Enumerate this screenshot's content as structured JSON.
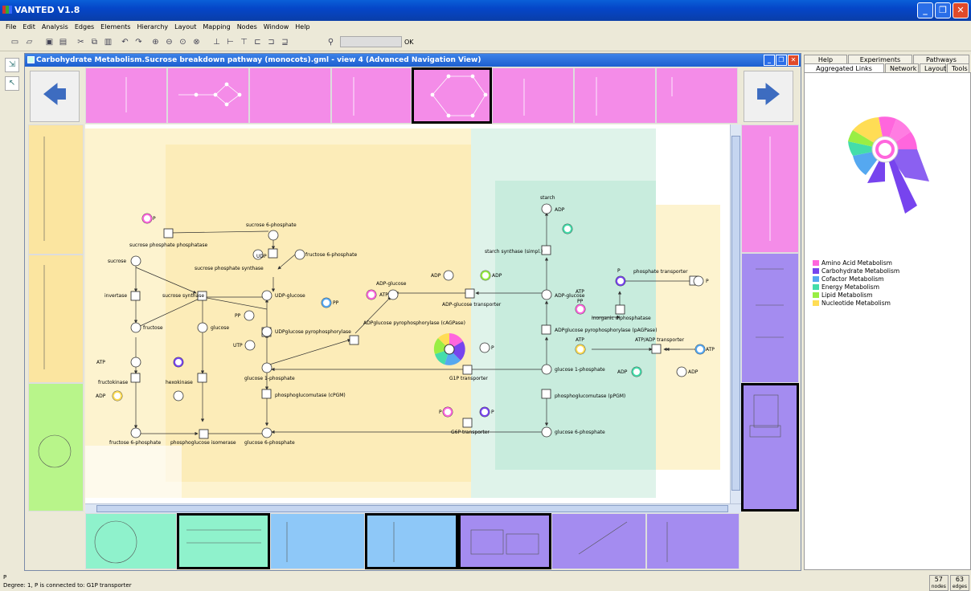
{
  "app": {
    "title": "VANTED V1.8"
  },
  "menu": [
    "File",
    "Edit",
    "Analysis",
    "Edges",
    "Elements",
    "Hierarchy",
    "Layout",
    "Mapping",
    "Nodes",
    "Window",
    "Help"
  ],
  "toolbar": {
    "search_value": "",
    "ok_label": "OK"
  },
  "internal_window": {
    "title": "Carbohydrate Metabolism.Sucrose breakdown pathway (monocots).gml - view 4 (Advanced Navigation View)"
  },
  "right_panel": {
    "tabs_row1": [
      "Help",
      "Experiments",
      "Pathways"
    ],
    "tabs_row2": [
      "Aggregated Links View",
      "Network",
      "Layout",
      "Tools"
    ],
    "active_tab": "Aggregated Links View",
    "legend": [
      {
        "label": "Amino Acid Metabolism",
        "color": "#ff66dd"
      },
      {
        "label": "Carbohydrate Metabolism",
        "color": "#7744ee"
      },
      {
        "label": "Cofactor Metabolism",
        "color": "#55a8f0"
      },
      {
        "label": "Energy Metabolism",
        "color": "#44ddaa"
      },
      {
        "label": "Lipid Metabolism",
        "color": "#99ee44"
      },
      {
        "label": "Nucleotide Metabolism",
        "color": "#ffdd55"
      }
    ]
  },
  "status": {
    "line1": "P",
    "line2": "Degree: 1, P is connected to: G1P transporter",
    "nodes": "57",
    "nodes_label": "nodes",
    "edges": "63",
    "edges_label": "edges"
  },
  "network": {
    "labels": [
      "sucrose 6-phosphate",
      "P",
      "sucrose phosphate phosphatase",
      "UDP",
      "fructose 6-phosphate",
      "sucrose",
      "sucrose phosphate synthase",
      "UDP-glucose",
      "invertase",
      "sucrose synthase",
      "fructose",
      "glucose",
      "PP",
      "UDPglucose pyrophosphorylase",
      "UTP",
      "ATP",
      "fructokinase",
      "hexokinase",
      "ADP",
      "glucose 1-phosphate",
      "phosphoglucomutase (cPGM)",
      "fructose 6-phosphate",
      "phosphoglucose isomerase",
      "glucose 6-phosphate",
      "ADP-glucose",
      "ADPglucose pyrophosphorylase (cAGPase)",
      "ADP-glucose transporter",
      "G1P transporter",
      "G6P transporter",
      "starch",
      "starch synthase (simpl.)",
      "ADPglucose pyrophosphorylase (pAGPase)",
      "inorganic diphosphatase",
      "phosphate transporter",
      "ATP/ADP transporter",
      "phosphoglucomutase (pPGM)"
    ]
  }
}
